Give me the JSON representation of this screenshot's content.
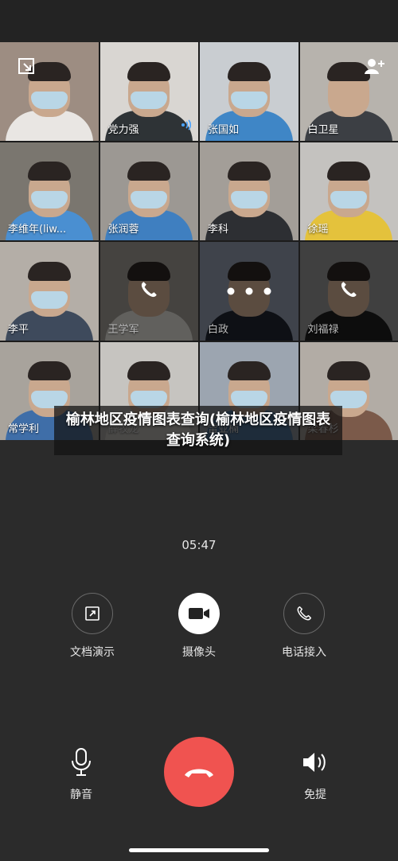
{
  "participants": [
    {
      "name": "",
      "bg": "#9d8d82",
      "body": "#e9e6e3",
      "mask": true,
      "dim": false
    },
    {
      "name": "党力强",
      "bg": "#d9d6d2",
      "body": "#2e3336",
      "mask": true,
      "dim": false,
      "speaking": true
    },
    {
      "name": "张国如",
      "bg": "#c9cdd1",
      "body": "#3f86c6",
      "mask": true,
      "dim": false
    },
    {
      "name": "白卫星",
      "bg": "#b7b3ad",
      "body": "#3c3f44",
      "mask": false,
      "dim": false
    },
    {
      "name": "李维年(liw...",
      "bg": "#7a766f",
      "body": "#4a8fd1",
      "mask": true,
      "dim": false
    },
    {
      "name": "张润蓉",
      "bg": "#9c9893",
      "body": "#3f7fc0",
      "mask": true,
      "dim": false
    },
    {
      "name": "李科",
      "bg": "#a39e98",
      "body": "#2d2f33",
      "mask": true,
      "dim": false
    },
    {
      "name": "徐瑶",
      "bg": "#c4c2bf",
      "body": "#e4c23c",
      "mask": true,
      "dim": false
    },
    {
      "name": "李平",
      "bg": "#b4aea7",
      "body": "#3e4a5c",
      "mask": true,
      "dim": false
    },
    {
      "name": "王学军",
      "bg": "#9a968f",
      "body": "#d7d4cf",
      "mask": false,
      "dim": true,
      "overlay": "phone"
    },
    {
      "name": "白政",
      "bg": "#8c96a6",
      "body": "#1f2430",
      "mask": false,
      "dim": true,
      "overlay": "dots"
    },
    {
      "name": "刘福禄",
      "bg": "#8e8e8e",
      "body": "#1e1e1e",
      "mask": false,
      "dim": true,
      "overlay": "phone"
    },
    {
      "name": "常学利",
      "bg": "#a8a39c",
      "body": "#3f6ea8",
      "mask": true,
      "dim": false
    },
    {
      "name": "薛牧龙",
      "bg": "#c6c4c0",
      "body": "#e6e2da",
      "mask": true,
      "dim": false
    },
    {
      "name": "雷亚楠",
      "bg": "#9ca5b0",
      "body": "#3f74ad",
      "mask": true,
      "dim": false
    },
    {
      "name": "梁春杉",
      "bg": "#b2aca5",
      "body": "#7b5a4a",
      "mask": true,
      "dim": false
    }
  ],
  "banner": {
    "text": "榆林地区疫情图表查询(榆林地区疫情图表查询系统)"
  },
  "call": {
    "duration": "05:47"
  },
  "controls": {
    "share_doc": "文档演示",
    "camera": "摄像头",
    "phone_join": "电话接入",
    "mute": "静音",
    "speaker": "免提"
  },
  "icons": [
    "minimize-icon",
    "add-user-icon",
    "speaking-icon",
    "phone-icon",
    "dots-icon",
    "share-icon",
    "video-camera-icon",
    "handset-icon",
    "microphone-icon",
    "speaker-icon",
    "hangup-icon"
  ]
}
